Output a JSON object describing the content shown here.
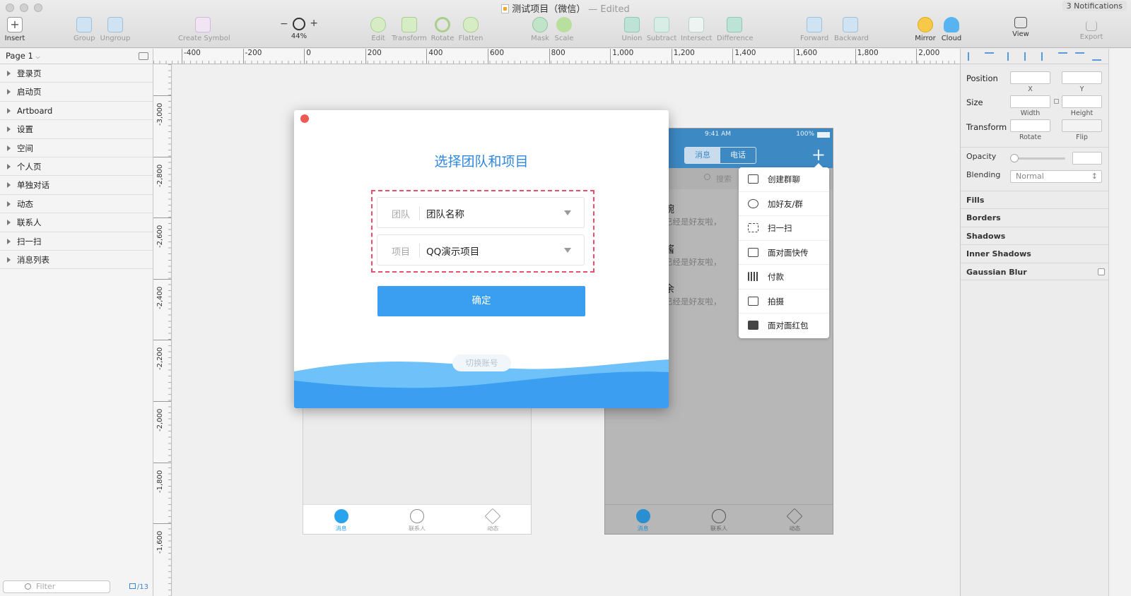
{
  "window": {
    "title": "测试项目（微信）",
    "edited": "— Edited",
    "notifications": "3 Notifications"
  },
  "toolbar": {
    "insert": "Insert",
    "group": "Group",
    "ungroup": "Ungroup",
    "create_symbol": "Create Symbol",
    "zoom": "44%",
    "zoom_minus": "−",
    "zoom_plus": "+",
    "edit": "Edit",
    "transform": "Transform",
    "rotate": "Rotate",
    "flatten": "Flatten",
    "mask": "Mask",
    "scale": "Scale",
    "union": "Union",
    "subtract": "Subtract",
    "intersect": "Intersect",
    "difference": "Difference",
    "forward": "Forward",
    "backward": "Backward",
    "mirror": "Mirror",
    "cloud": "Cloud",
    "view": "View",
    "export": "Export"
  },
  "sidebar": {
    "page": "Page 1",
    "layers": [
      "登录页",
      "启动页",
      "Artboard",
      "设置",
      "空间",
      "个人页",
      "单独对话",
      "动态",
      "联系人",
      "扫一扫",
      "消息列表"
    ],
    "filter_placeholder": "Filter",
    "layer_count": "13"
  },
  "ruler": {
    "h_ticks": [
      "-400",
      "-200",
      "0",
      "200",
      "400",
      "600",
      "800",
      "1,000",
      "1,200",
      "1,400",
      "1,600",
      "1,800",
      "2,000"
    ],
    "v_ticks": [
      "-3,000",
      "-2,800",
      "-2,600",
      "-2,400",
      "-2,200",
      "-2,000",
      "-1,800",
      "-1,600"
    ]
  },
  "dialog": {
    "title": "选择团队和项目",
    "team_label": "团队",
    "team_value": "团队名称",
    "project_label": "项目",
    "project_value": "QQ演示项目",
    "confirm": "确定",
    "switch_account": "切换账号"
  },
  "phone_left": {
    "tabs": [
      "消息",
      "联系人",
      "动态"
    ]
  },
  "phone_right": {
    "time": "9:41 AM",
    "battery": "100%",
    "seg_messages": "消息",
    "seg_calls": "电话",
    "search": "搜索",
    "chats": [
      {
        "name": "婉",
        "msg": "已经是好友啦，"
      },
      {
        "name": "酱",
        "msg": "已经是好友啦，"
      },
      {
        "name": "余",
        "msg": "已经是好友啦，"
      }
    ],
    "tabs": [
      "消息",
      "联系人",
      "动态"
    ]
  },
  "popup_menu": [
    "创建群聊",
    "加好友/群",
    "扫一扫",
    "面对面快传",
    "付款",
    "拍摄",
    "面对面红包"
  ],
  "inspector": {
    "position": "Position",
    "x": "X",
    "y": "Y",
    "size": "Size",
    "width": "Width",
    "height": "Height",
    "transform": "Transform",
    "rotate": "Rotate",
    "flip": "Flip",
    "opacity": "Opacity",
    "blending": "Blending",
    "blending_value": "Normal",
    "fills": "Fills",
    "borders": "Borders",
    "shadows": "Shadows",
    "inner_shadows": "Inner Shadows",
    "gaussian_blur": "Gaussian Blur"
  },
  "colors": {
    "accent": "#3a9ff0",
    "title_blue": "#2f87e0",
    "highlight_dash": "#ec4f6c",
    "arrow": "#f4506e"
  }
}
